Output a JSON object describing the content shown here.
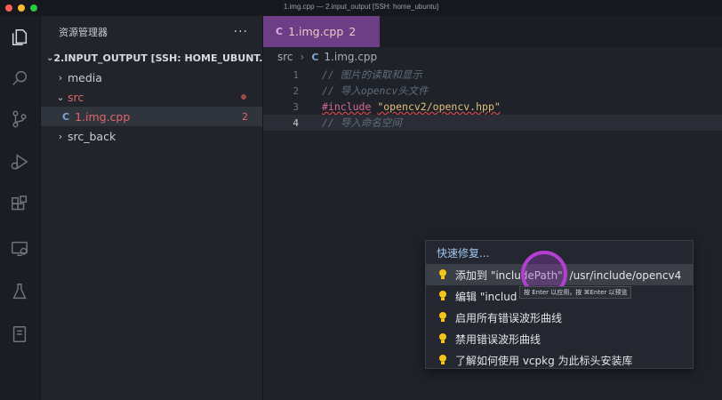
{
  "window": {
    "title": "1.img.cpp — 2.input_output [SSH: home_ubuntu]"
  },
  "activity_bar": [
    "files-icon",
    "search-icon",
    "source-control-icon",
    "run-debug-icon",
    "extensions-icon",
    "remote-explorer-icon",
    "testing-icon",
    "notebook-icon"
  ],
  "sidebar": {
    "title": "资源管理器",
    "more": "···",
    "section_title": "2.INPUT_OUTPUT [SSH: HOME_UBUNT...",
    "items": [
      {
        "label": "media",
        "twist": "›"
      },
      {
        "label": "src",
        "twist": "⌄"
      },
      {
        "label": "1.img.cpp",
        "badge": "2"
      },
      {
        "label": "src_back",
        "twist": "›"
      }
    ]
  },
  "tab": {
    "label": "1.img.cpp",
    "count": "2"
  },
  "breadcrumb": {
    "folder": "src",
    "file": "1.img.cpp"
  },
  "editor": {
    "lines": [
      {
        "num": "1",
        "text": "// 图片的读取和显示"
      },
      {
        "num": "2",
        "text": "// 导入opencv头文件"
      },
      {
        "num": "3",
        "directive": "#include",
        "string": "\"opencv2/opencv.hpp\""
      },
      {
        "num": "4",
        "text": "// 导入命名空间"
      }
    ]
  },
  "quick_fix": {
    "title": "快速修复...",
    "items": [
      "添加到 \"includePath\": /usr/include/opencv4",
      "编辑 \"includ",
      "启用所有错误波形曲线",
      "禁用错误波形曲线",
      "了解如何使用 vcpkg 为此标头安装库"
    ],
    "tooltip": "按 Enter 以应用，按 ⌘Enter 以预览"
  },
  "colors": {
    "accent_tab": "#6d3d86",
    "error": "#e0676a",
    "bulb": "#f5c518",
    "cursor_ring": "#b23fd0"
  }
}
